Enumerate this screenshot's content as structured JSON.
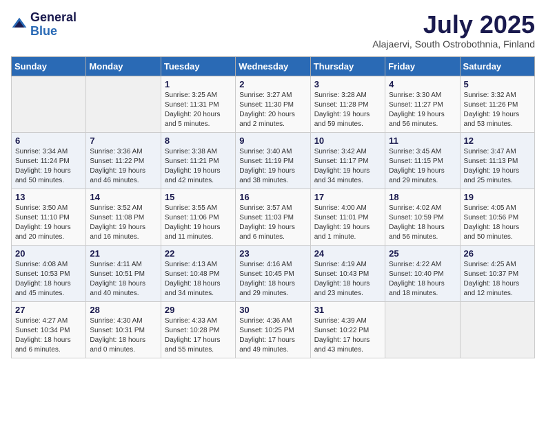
{
  "logo": {
    "general": "General",
    "blue": "Blue"
  },
  "title": "July 2025",
  "subtitle": "Alajaervi, South Ostrobothnia, Finland",
  "days_of_week": [
    "Sunday",
    "Monday",
    "Tuesday",
    "Wednesday",
    "Thursday",
    "Friday",
    "Saturday"
  ],
  "weeks": [
    [
      {
        "day": "",
        "info": ""
      },
      {
        "day": "",
        "info": ""
      },
      {
        "day": "1",
        "info": "Sunrise: 3:25 AM\nSunset: 11:31 PM\nDaylight: 20 hours\nand 5 minutes."
      },
      {
        "day": "2",
        "info": "Sunrise: 3:27 AM\nSunset: 11:30 PM\nDaylight: 20 hours\nand 2 minutes."
      },
      {
        "day": "3",
        "info": "Sunrise: 3:28 AM\nSunset: 11:28 PM\nDaylight: 19 hours\nand 59 minutes."
      },
      {
        "day": "4",
        "info": "Sunrise: 3:30 AM\nSunset: 11:27 PM\nDaylight: 19 hours\nand 56 minutes."
      },
      {
        "day": "5",
        "info": "Sunrise: 3:32 AM\nSunset: 11:26 PM\nDaylight: 19 hours\nand 53 minutes."
      }
    ],
    [
      {
        "day": "6",
        "info": "Sunrise: 3:34 AM\nSunset: 11:24 PM\nDaylight: 19 hours\nand 50 minutes."
      },
      {
        "day": "7",
        "info": "Sunrise: 3:36 AM\nSunset: 11:22 PM\nDaylight: 19 hours\nand 46 minutes."
      },
      {
        "day": "8",
        "info": "Sunrise: 3:38 AM\nSunset: 11:21 PM\nDaylight: 19 hours\nand 42 minutes."
      },
      {
        "day": "9",
        "info": "Sunrise: 3:40 AM\nSunset: 11:19 PM\nDaylight: 19 hours\nand 38 minutes."
      },
      {
        "day": "10",
        "info": "Sunrise: 3:42 AM\nSunset: 11:17 PM\nDaylight: 19 hours\nand 34 minutes."
      },
      {
        "day": "11",
        "info": "Sunrise: 3:45 AM\nSunset: 11:15 PM\nDaylight: 19 hours\nand 29 minutes."
      },
      {
        "day": "12",
        "info": "Sunrise: 3:47 AM\nSunset: 11:13 PM\nDaylight: 19 hours\nand 25 minutes."
      }
    ],
    [
      {
        "day": "13",
        "info": "Sunrise: 3:50 AM\nSunset: 11:10 PM\nDaylight: 19 hours\nand 20 minutes."
      },
      {
        "day": "14",
        "info": "Sunrise: 3:52 AM\nSunset: 11:08 PM\nDaylight: 19 hours\nand 16 minutes."
      },
      {
        "day": "15",
        "info": "Sunrise: 3:55 AM\nSunset: 11:06 PM\nDaylight: 19 hours\nand 11 minutes."
      },
      {
        "day": "16",
        "info": "Sunrise: 3:57 AM\nSunset: 11:03 PM\nDaylight: 19 hours\nand 6 minutes."
      },
      {
        "day": "17",
        "info": "Sunrise: 4:00 AM\nSunset: 11:01 PM\nDaylight: 19 hours\nand 1 minute."
      },
      {
        "day": "18",
        "info": "Sunrise: 4:02 AM\nSunset: 10:59 PM\nDaylight: 18 hours\nand 56 minutes."
      },
      {
        "day": "19",
        "info": "Sunrise: 4:05 AM\nSunset: 10:56 PM\nDaylight: 18 hours\nand 50 minutes."
      }
    ],
    [
      {
        "day": "20",
        "info": "Sunrise: 4:08 AM\nSunset: 10:53 PM\nDaylight: 18 hours\nand 45 minutes."
      },
      {
        "day": "21",
        "info": "Sunrise: 4:11 AM\nSunset: 10:51 PM\nDaylight: 18 hours\nand 40 minutes."
      },
      {
        "day": "22",
        "info": "Sunrise: 4:13 AM\nSunset: 10:48 PM\nDaylight: 18 hours\nand 34 minutes."
      },
      {
        "day": "23",
        "info": "Sunrise: 4:16 AM\nSunset: 10:45 PM\nDaylight: 18 hours\nand 29 minutes."
      },
      {
        "day": "24",
        "info": "Sunrise: 4:19 AM\nSunset: 10:43 PM\nDaylight: 18 hours\nand 23 minutes."
      },
      {
        "day": "25",
        "info": "Sunrise: 4:22 AM\nSunset: 10:40 PM\nDaylight: 18 hours\nand 18 minutes."
      },
      {
        "day": "26",
        "info": "Sunrise: 4:25 AM\nSunset: 10:37 PM\nDaylight: 18 hours\nand 12 minutes."
      }
    ],
    [
      {
        "day": "27",
        "info": "Sunrise: 4:27 AM\nSunset: 10:34 PM\nDaylight: 18 hours\nand 6 minutes."
      },
      {
        "day": "28",
        "info": "Sunrise: 4:30 AM\nSunset: 10:31 PM\nDaylight: 18 hours\nand 0 minutes."
      },
      {
        "day": "29",
        "info": "Sunrise: 4:33 AM\nSunset: 10:28 PM\nDaylight: 17 hours\nand 55 minutes."
      },
      {
        "day": "30",
        "info": "Sunrise: 4:36 AM\nSunset: 10:25 PM\nDaylight: 17 hours\nand 49 minutes."
      },
      {
        "day": "31",
        "info": "Sunrise: 4:39 AM\nSunset: 10:22 PM\nDaylight: 17 hours\nand 43 minutes."
      },
      {
        "day": "",
        "info": ""
      },
      {
        "day": "",
        "info": ""
      }
    ]
  ]
}
